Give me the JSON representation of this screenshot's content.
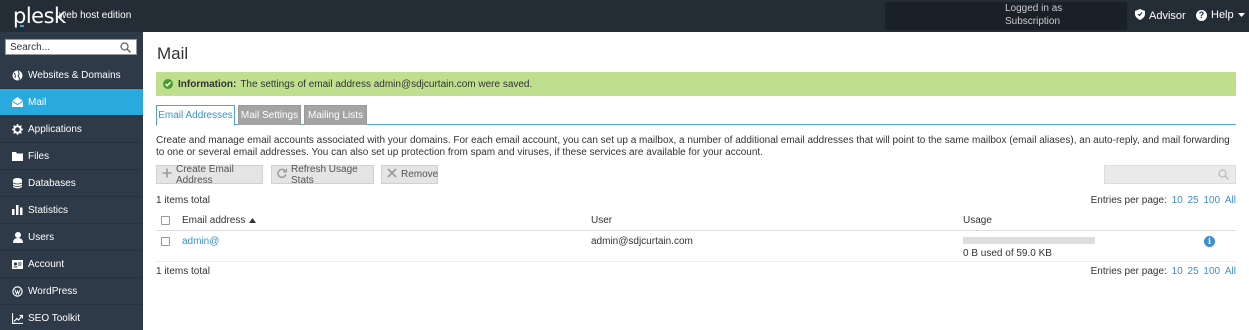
{
  "header": {
    "logo": "plesk",
    "edition": "web host edition",
    "logged_in": "Logged in as",
    "subscription": "Subscription",
    "advisor": "Advisor",
    "help": "Help"
  },
  "sidebar": {
    "search_placeholder": "Search...",
    "items": [
      {
        "label": "Websites & Domains",
        "icon": "globe-icon"
      },
      {
        "label": "Mail",
        "icon": "mail-icon",
        "active": true
      },
      {
        "label": "Applications",
        "icon": "gear-icon"
      },
      {
        "label": "Files",
        "icon": "folder-icon"
      },
      {
        "label": "Databases",
        "icon": "database-icon"
      },
      {
        "label": "Statistics",
        "icon": "bar-chart-icon"
      },
      {
        "label": "Users",
        "icon": "user-icon"
      },
      {
        "label": "Account",
        "icon": "id-card-icon"
      },
      {
        "label": "WordPress",
        "icon": "wordpress-icon"
      },
      {
        "label": "SEO Toolkit",
        "icon": "trend-icon"
      }
    ]
  },
  "main": {
    "title": "Mail",
    "info_label": "Information:",
    "info_text": "The settings of email address admin@sdjcurtain.com were saved.",
    "tabs": [
      "Email Addresses",
      "Mail Settings",
      "Mailing Lists"
    ],
    "description": "Create and manage email accounts associated with your domains. For each email account, you can set up a mailbox, a number of additional email addresses that will point to the same mailbox (email aliases), an auto-reply, and mail forwarding to one or several email addresses. You can also set up protection from spam and viruses, if these services are available for your account.",
    "toolbar": {
      "create": "Create Email Address",
      "refresh": "Refresh Usage Stats",
      "remove": "Remove"
    },
    "items_total": "1 items total",
    "entries_label": "Entries per page:",
    "entries_options": [
      "10",
      "25",
      "100",
      "All"
    ],
    "columns": {
      "email": "Email address",
      "user": "User",
      "usage": "Usage"
    },
    "rows": [
      {
        "email": "admin@",
        "user": "admin@sdjcurtain.com",
        "usage_text": "0 B used of 59.0 KB",
        "usage_fraction": 0
      }
    ]
  },
  "colors": {
    "topbar": "#242c36",
    "sidebar": "#2e3a47",
    "active_nav": "#28aade",
    "info_bg": "#c0df8e",
    "link": "#3a8fd0"
  }
}
